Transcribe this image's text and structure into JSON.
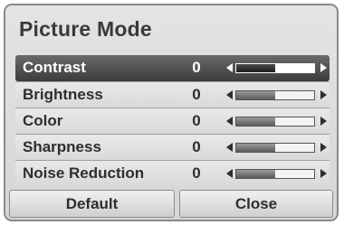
{
  "dialog": {
    "title": "Picture Mode"
  },
  "settings": [
    {
      "label": "Contrast",
      "value": "0",
      "level": 0.5,
      "selected": true
    },
    {
      "label": "Brightness",
      "value": "0",
      "level": 0.5,
      "selected": false
    },
    {
      "label": "Color",
      "value": "0",
      "level": 0.5,
      "selected": false
    },
    {
      "label": "Sharpness",
      "value": "0",
      "level": 0.5,
      "selected": false
    },
    {
      "label": "Noise Reduction",
      "value": "0",
      "level": 0.5,
      "selected": false
    }
  ],
  "buttons": {
    "default_label": "Default",
    "close_label": "Close"
  }
}
